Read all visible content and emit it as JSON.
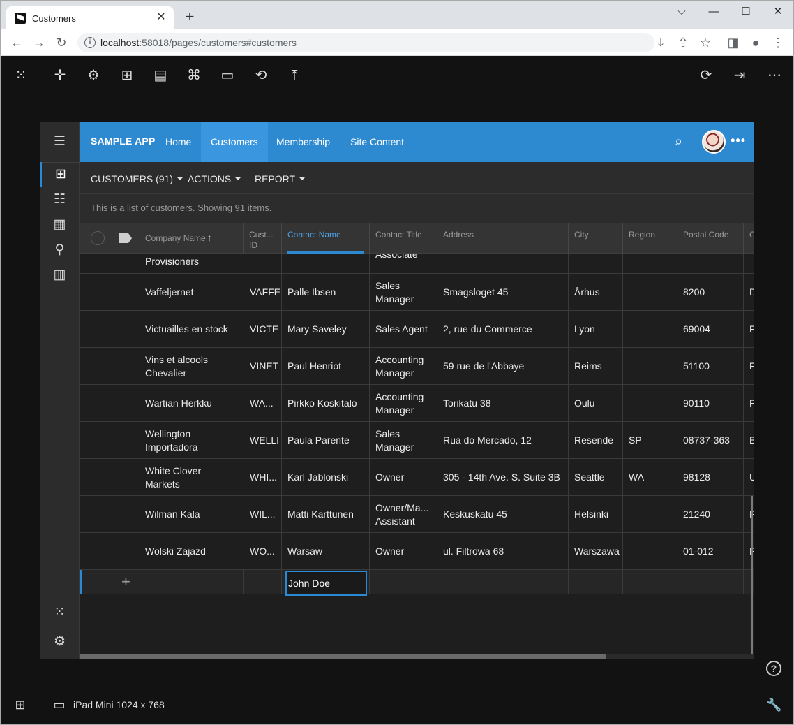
{
  "browser": {
    "tab_title": "Customers",
    "url_host": "localhost",
    "url_rest": ":58018/pages/customers#customers",
    "close_glyph": "✕",
    "newtab_glyph": "+"
  },
  "window": {
    "minimize": "⌵",
    "maximize": "—",
    "restore": "☐",
    "close": "✕"
  },
  "devbar": {
    "icons": [
      "apps-grid-icon",
      "crosshair-icon",
      "gear-icon",
      "sitemap-icon",
      "book-icon",
      "webhook-icon",
      "folder-icon",
      "sync-icon",
      "publish-icon",
      "refresh-icon",
      "exit-icon",
      "more-icon"
    ]
  },
  "app": {
    "brand": "SAMPLE APP",
    "nav": [
      "Home",
      "Customers",
      "Membership",
      "Site Content"
    ],
    "active_nav": "Customers",
    "accent": "#2d89d0"
  },
  "viewbar": {
    "view_selector": "CUSTOMERS (91)",
    "actions": "ACTIONS",
    "report": "REPORT"
  },
  "description": "This is a list of customers. Showing 91 items.",
  "grid": {
    "columns": [
      "Company Name",
      "Cust... ID",
      "Contact Name",
      "Contact Title",
      "Address",
      "City",
      "Region",
      "Postal Code",
      "C"
    ],
    "sorted_column": "Company Name",
    "focused_column": "Contact Name",
    "partial_row": {
      "company": "Provisioners",
      "title": "Associate"
    },
    "rows": [
      {
        "company": "Vaffeljernet",
        "id": "VAFFE",
        "contact": "Palle Ibsen",
        "title": "Sales Manager",
        "address": "Smagsloget 45",
        "city": "Århus",
        "region": "",
        "postal": "8200",
        "country": "D"
      },
      {
        "company": "Victuailles en stock",
        "id": "VICTE",
        "contact": "Mary Saveley",
        "title": "Sales Agent",
        "address": "2, rue du Commerce",
        "city": "Lyon",
        "region": "",
        "postal": "69004",
        "country": "F"
      },
      {
        "company": "Vins et alcools Chevalier",
        "id": "VINET",
        "contact": "Paul Henriot",
        "title": "Accounting Manager",
        "address": "59 rue de l'Abbaye",
        "city": "Reims",
        "region": "",
        "postal": "51100",
        "country": "F"
      },
      {
        "company": "Wartian Herkku",
        "id": "WA...",
        "contact": "Pirkko Koskitalo",
        "title": "Accounting Manager",
        "address": "Torikatu 38",
        "city": "Oulu",
        "region": "",
        "postal": "90110",
        "country": "F"
      },
      {
        "company": "Wellington Importadora",
        "id": "WELLI",
        "contact": "Paula Parente",
        "title": "Sales Manager",
        "address": "Rua do Mercado, 12",
        "city": "Resende",
        "region": "SP",
        "postal": "08737-363",
        "country": "B"
      },
      {
        "company": "White Clover Markets",
        "id": "WHI...",
        "contact": "Karl Jablonski",
        "title": "Owner",
        "address": "305 - 14th Ave. S. Suite 3B",
        "city": "Seattle",
        "region": "WA",
        "postal": "98128",
        "country": "U"
      },
      {
        "company": "Wilman Kala",
        "id": "WIL...",
        "contact": "Matti Karttunen",
        "title": "Owner/Ma... Assistant",
        "address": "Keskuskatu 45",
        "city": "Helsinki",
        "region": "",
        "postal": "21240",
        "country": "F"
      },
      {
        "company": "Wolski Zajazd",
        "id": "WO...",
        "contact": "Warsaw",
        "title": "Owner",
        "address": "ul. Filtrowa 68",
        "city": "Warszawa",
        "region": "",
        "postal": "01-012",
        "country": "P"
      }
    ],
    "new_row": {
      "contact_value": "John Doe",
      "add_glyph": "+"
    }
  },
  "footer": {
    "device_label": "iPad Mini 1024 x 768",
    "help_glyph": "?"
  }
}
